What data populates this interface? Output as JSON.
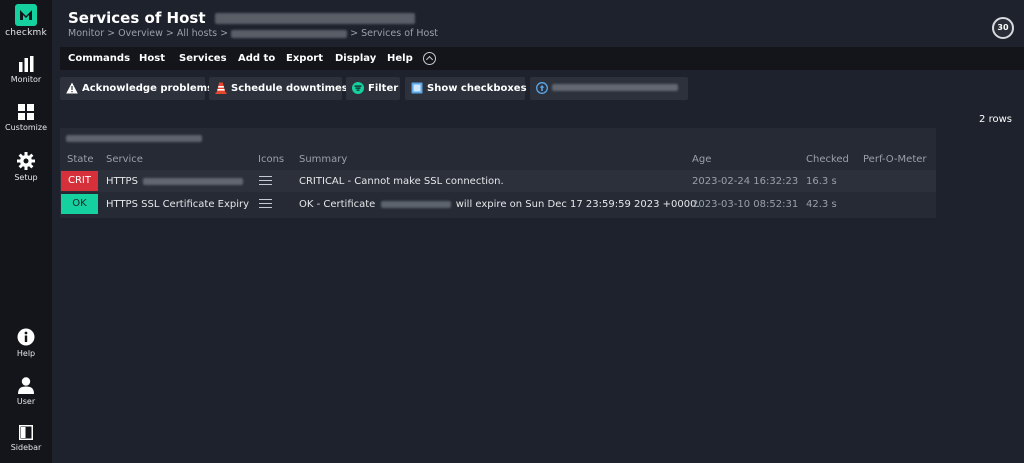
{
  "app": {
    "logo_text": "checkmk",
    "brand_color": "#15d1a0"
  },
  "sidebar": {
    "items": [
      {
        "label": "Monitor",
        "icon": "bar-chart-icon"
      },
      {
        "label": "Customize",
        "icon": "grid-icon"
      },
      {
        "label": "Setup",
        "icon": "gear-icon"
      },
      {
        "label": "Help",
        "icon": "info-icon"
      },
      {
        "label": "User",
        "icon": "user-icon"
      },
      {
        "label": "Sidebar",
        "icon": "sidebar-icon"
      }
    ]
  },
  "header": {
    "title": "Services of Host",
    "breadcrumb": {
      "monitor": "Monitor",
      "overview": "Overview",
      "all_hosts": "All hosts",
      "current": "Services of Host"
    },
    "reload_seconds": "30"
  },
  "menubar": {
    "items": [
      "Commands",
      "Host",
      "Services",
      "Add to",
      "Export",
      "Display",
      "Help"
    ]
  },
  "actions": {
    "acknowledge": "Acknowledge problems",
    "schedule": "Schedule downtimes",
    "filter": "Filter",
    "checkboxes": "Show checkboxes"
  },
  "row_count": "2 rows",
  "table": {
    "columns": [
      "State",
      "Service",
      "Icons",
      "Summary",
      "Age",
      "Checked",
      "Perf-O-Meter"
    ],
    "rows": [
      {
        "state": "CRIT",
        "service": "HTTPS",
        "summary": "CRITICAL - Cannot make SSL connection.",
        "age": "2023-02-24 16:32:23",
        "checked": "16.3 s"
      },
      {
        "state": "OK",
        "service": "HTTPS SSL Certificate Expiry",
        "summary_prefix": "OK - Certificate",
        "summary_suffix": "will expire on Sun Dec 17 23:59:59 2023 +0000.",
        "age": "2023-03-10 08:52:31",
        "checked": "42.3 s"
      }
    ]
  },
  "colors": {
    "crit": "#d6313a",
    "ok": "#15d1a0"
  }
}
